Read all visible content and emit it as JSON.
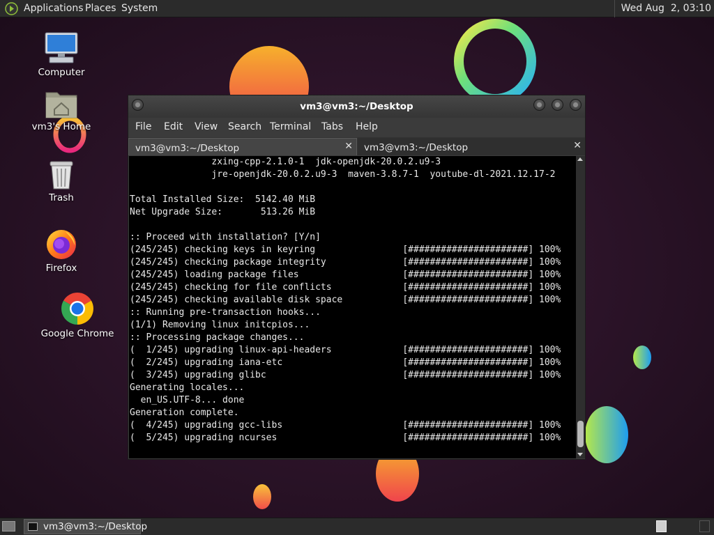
{
  "top_panel": {
    "menus": [
      "Applications",
      "Places",
      "System"
    ],
    "clock": "Wed Aug  2, 03:10"
  },
  "desktop_icons": [
    {
      "label": "Computer",
      "icon": "computer-icon"
    },
    {
      "label": "vm3's Home",
      "icon": "home-folder-icon"
    },
    {
      "label": "Trash",
      "icon": "trash-icon"
    },
    {
      "label": "Firefox",
      "icon": "firefox-icon"
    },
    {
      "label": "Google Chrome",
      "icon": "chrome-icon"
    }
  ],
  "window": {
    "title": "vm3@vm3:~/Desktop",
    "menu": [
      "File",
      "Edit",
      "View",
      "Search",
      "Terminal",
      "Tabs",
      "Help"
    ],
    "tabs": [
      {
        "label": "vm3@vm3:~/Desktop",
        "active": true
      },
      {
        "label": "vm3@vm3:~/Desktop",
        "active": false
      }
    ],
    "terminal_lines": [
      "               zxing-cpp-2.1.0-1  jdk-openjdk-20.0.2.u9-3",
      "               jre-openjdk-20.0.2.u9-3  maven-3.8.7-1  youtube-dl-2021.12.17-2",
      "",
      "Total Installed Size:  5142.40 MiB",
      "Net Upgrade Size:       513.26 MiB",
      "",
      ":: Proceed with installation? [Y/n]",
      "(245/245) checking keys in keyring                [######################] 100%",
      "(245/245) checking package integrity              [######################] 100%",
      "(245/245) loading package files                   [######################] 100%",
      "(245/245) checking for file conflicts             [######################] 100%",
      "(245/245) checking available disk space           [######################] 100%",
      ":: Running pre-transaction hooks...",
      "(1/1) Removing linux initcpios...",
      ":: Processing package changes...",
      "(  1/245) upgrading linux-api-headers             [######################] 100%",
      "(  2/245) upgrading iana-etc                      [######################] 100%",
      "(  3/245) upgrading glibc                         [######################] 100%",
      "Generating locales...",
      "  en_US.UTF-8... done",
      "Generation complete.",
      "(  4/245) upgrading gcc-libs                      [######################] 100%",
      "(  5/245) upgrading ncurses                       [######################] 100%"
    ]
  },
  "taskbar": {
    "task": "vm3@vm3:~/Desktop"
  }
}
